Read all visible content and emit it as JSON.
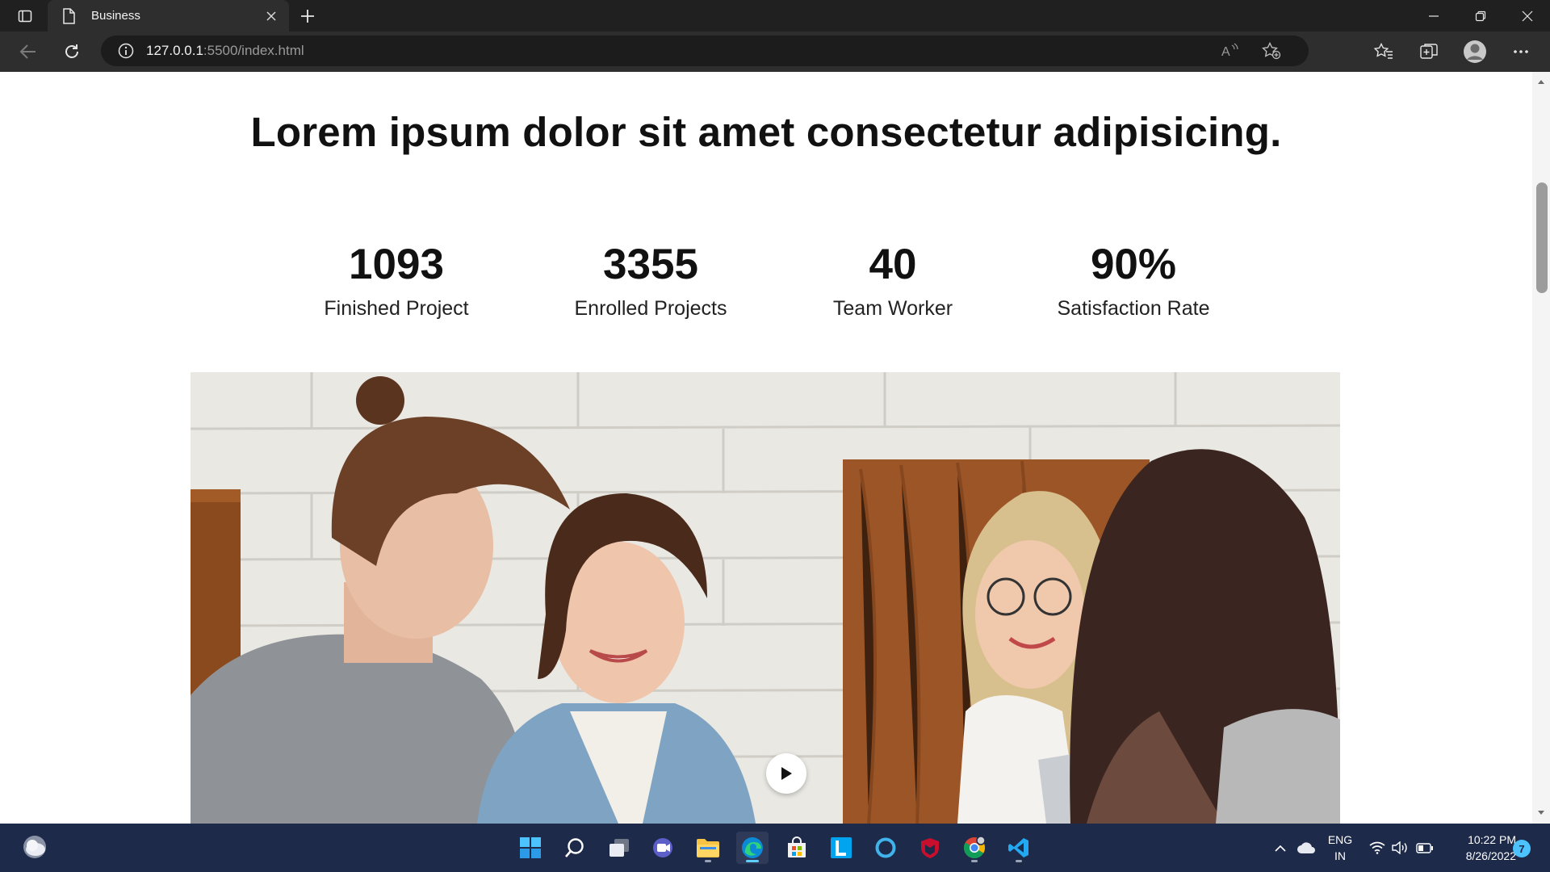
{
  "browser": {
    "tab": {
      "title": "Business"
    },
    "address": {
      "url_host": "127.0.0.1",
      "url_rest": ":5500/index.html"
    }
  },
  "page": {
    "headline": "Lorem ipsum dolor sit amet consectetur adipisicing.",
    "stats": [
      {
        "value": "1093",
        "label": "Finished Project"
      },
      {
        "value": "3355",
        "label": "Enrolled Projects"
      },
      {
        "value": "40",
        "label": "Team Worker"
      },
      {
        "value": "90%",
        "label": "Satisfaction Rate"
      }
    ]
  },
  "taskbar": {
    "language": {
      "line1": "ENG",
      "line2": "IN"
    },
    "clock": {
      "time": "10:22 PM",
      "date": "8/26/2022"
    },
    "notification_count": "7"
  },
  "colors": {
    "chrome_dark": "#202020",
    "toolbar": "#2e2e2e",
    "page_bg": "#ffffff",
    "taskbar_bg": "#1d2a4a",
    "edge_accent": "#60cdff"
  }
}
